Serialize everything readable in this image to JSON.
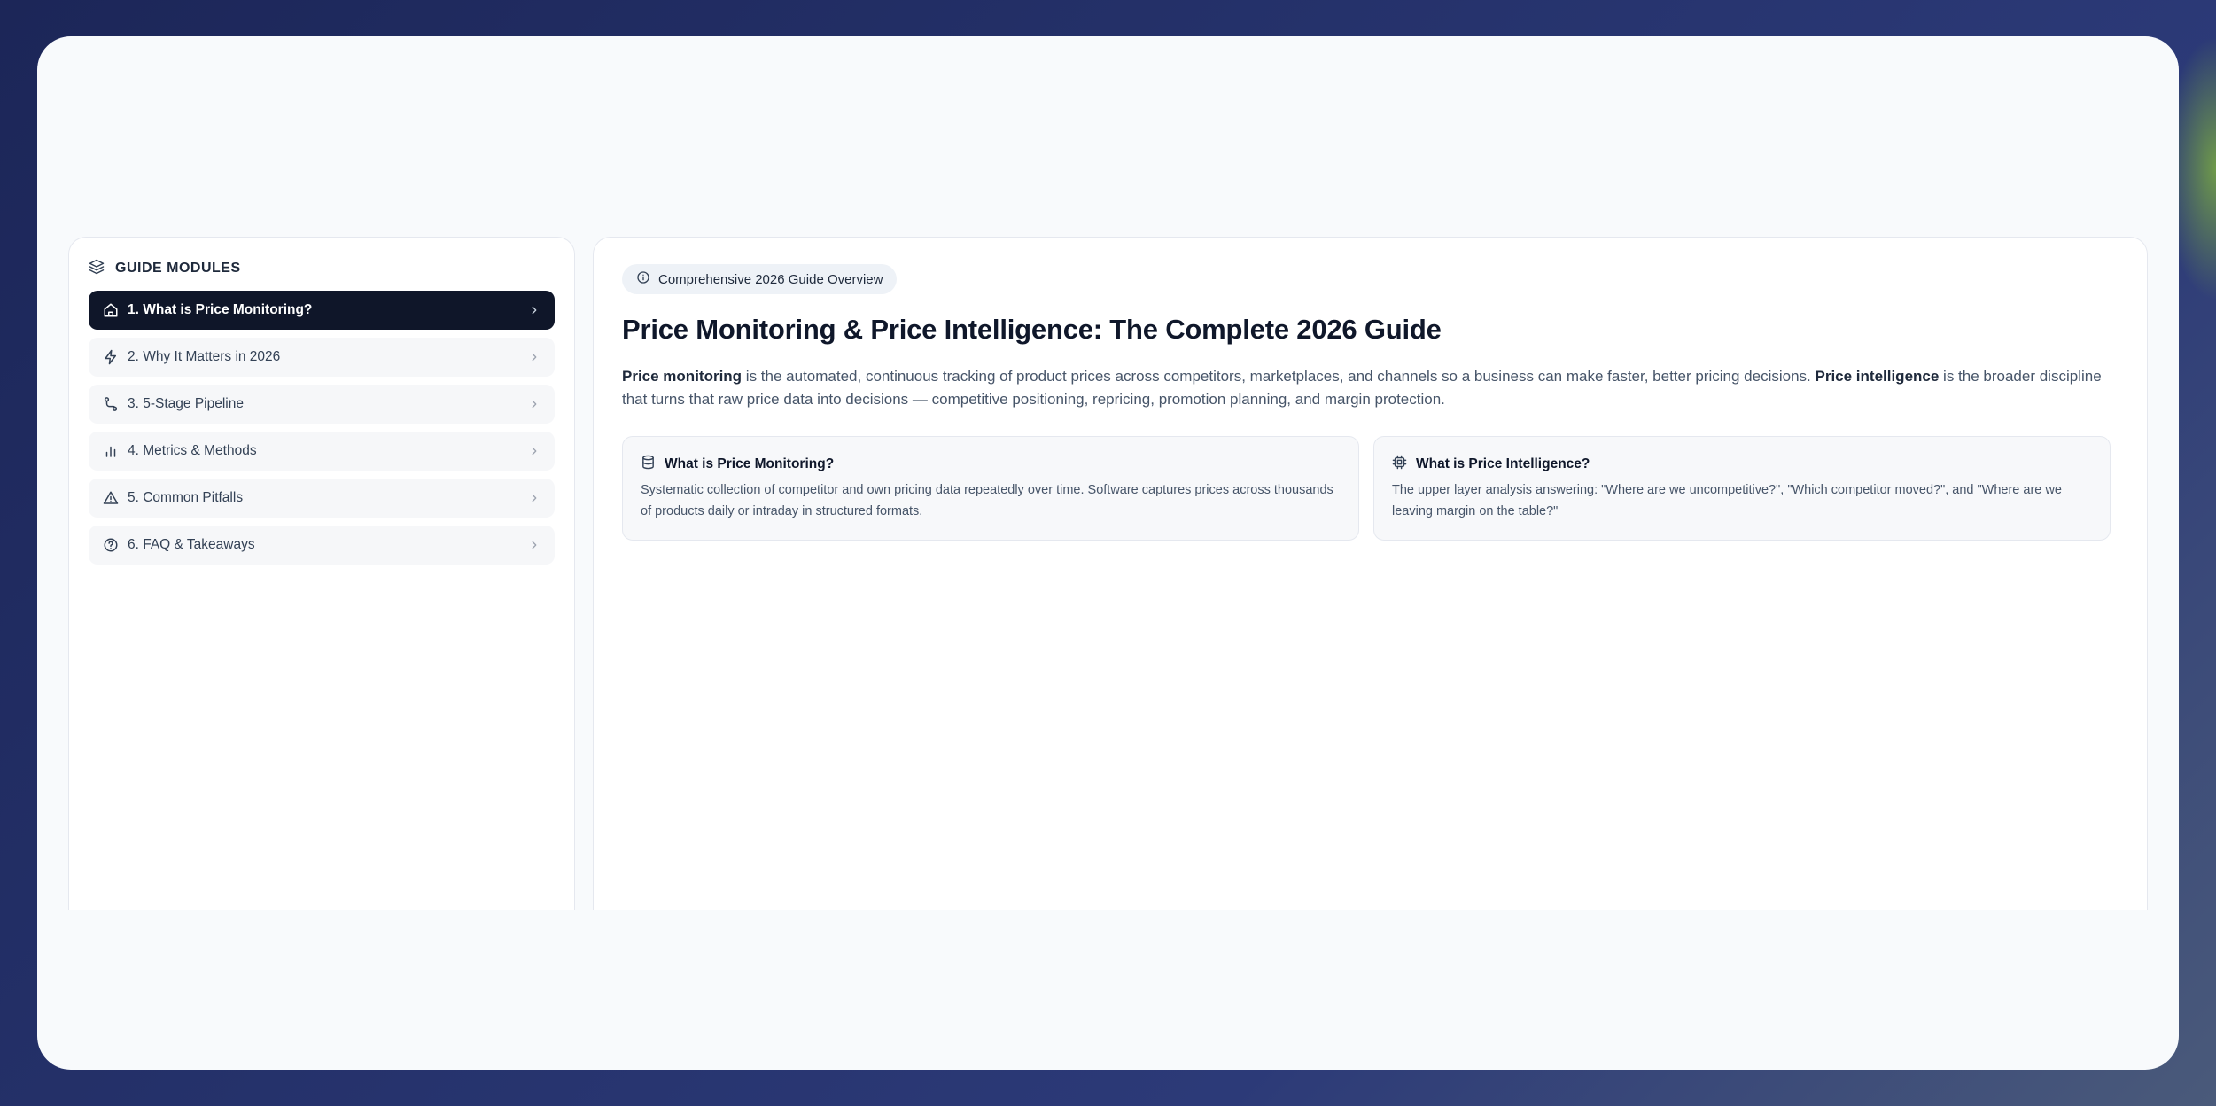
{
  "sidebar": {
    "header": "GUIDE MODULES",
    "items": [
      {
        "label": "1. What is Price Monitoring?",
        "icon": "home-icon",
        "active": true
      },
      {
        "label": "2. Why It Matters in 2026",
        "icon": "lightning-icon",
        "active": false
      },
      {
        "label": "3. 5-Stage Pipeline",
        "icon": "route-icon",
        "active": false
      },
      {
        "label": "4. Metrics & Methods",
        "icon": "bar-chart-icon",
        "active": false
      },
      {
        "label": "5. Common Pitfalls",
        "icon": "warning-icon",
        "active": false
      },
      {
        "label": "6. FAQ & Takeaways",
        "icon": "help-circle-icon",
        "active": false
      }
    ]
  },
  "main": {
    "badge": "Comprehensive 2026 Guide Overview",
    "title": "Price Monitoring & Price Intelligence: The Complete 2026 Guide",
    "intro": {
      "term1": "Price monitoring",
      "text1": " is the automated, continuous tracking of product prices across competitors, marketplaces, and channels so a business can make faster, better pricing decisions. ",
      "term2": "Price intelligence",
      "text2": " is the broader discipline that turns that raw price data into decisions — competitive positioning, repricing, promotion planning, and margin protection."
    },
    "cards": [
      {
        "title": "What is Price Monitoring?",
        "icon": "database-icon",
        "body": "Systematic collection of competitor and own pricing data repeatedly over time. Software captures prices across thousands of products daily or intraday in structured formats."
      },
      {
        "title": "What is Price Intelligence?",
        "icon": "chip-icon",
        "body": "The upper layer analysis answering: \"Where are we uncompetitive?\", \"Which competitor moved?\", and \"Where are we leaving margin on the table?\""
      }
    ]
  }
}
